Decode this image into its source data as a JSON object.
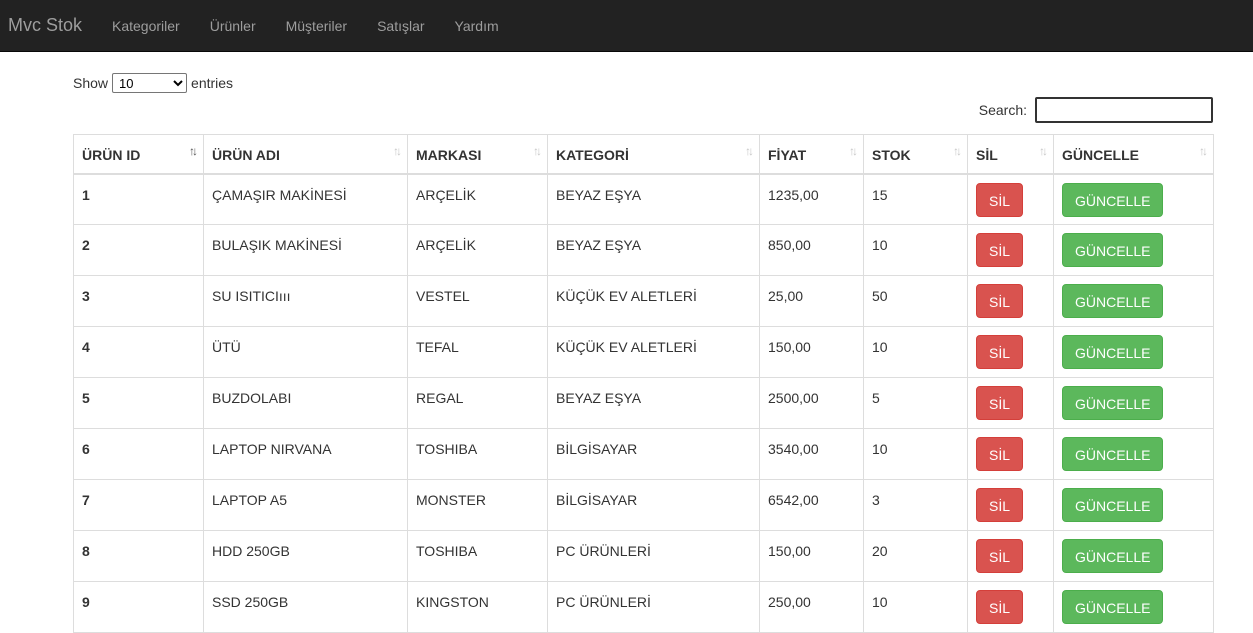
{
  "navbar": {
    "brand": "Mvc Stok",
    "links": [
      "Kategoriler",
      "Ürünler",
      "Müşteriler",
      "Satışlar",
      "Yardım"
    ]
  },
  "length": {
    "show_label": "Show",
    "selected": "10",
    "entries_label": "entries"
  },
  "search": {
    "label": "Search:",
    "value": ""
  },
  "table": {
    "headers": [
      "ÜRÜN ID",
      "ÜRÜN ADI",
      "MARKASI",
      "KATEGORİ",
      "FİYAT",
      "STOK",
      "SİL",
      "GÜNCELLE"
    ],
    "delete_label": "SİL",
    "update_label": "GÜNCELLE",
    "rows": [
      {
        "id": "1",
        "name": "ÇAMAŞIR MAKİNESİ",
        "brand": "ARÇELİK",
        "category": "BEYAZ EŞYA",
        "price": "1235,00",
        "stock": "15"
      },
      {
        "id": "2",
        "name": "BULAŞIK MAKİNESİ",
        "brand": "ARÇELİK",
        "category": "BEYAZ EŞYA",
        "price": "850,00",
        "stock": "10"
      },
      {
        "id": "3",
        "name": "SU ISITICIııı",
        "brand": "VESTEL",
        "category": "KÜÇÜK EV ALETLERİ",
        "price": "25,00",
        "stock": "50"
      },
      {
        "id": "4",
        "name": "ÜTÜ",
        "brand": "TEFAL",
        "category": "KÜÇÜK EV ALETLERİ",
        "price": "150,00",
        "stock": "10"
      },
      {
        "id": "5",
        "name": "BUZDOLABI",
        "brand": "REGAL",
        "category": "BEYAZ EŞYA",
        "price": "2500,00",
        "stock": "5"
      },
      {
        "id": "6",
        "name": "LAPTOP NIRVANA",
        "brand": "TOSHIBA",
        "category": "BİLGİSAYAR",
        "price": "3540,00",
        "stock": "10"
      },
      {
        "id": "7",
        "name": "LAPTOP A5",
        "brand": "MONSTER",
        "category": "BİLGİSAYAR",
        "price": "6542,00",
        "stock": "3"
      },
      {
        "id": "8",
        "name": "HDD 250GB",
        "brand": "TOSHIBA",
        "category": "PC ÜRÜNLERİ",
        "price": "150,00",
        "stock": "20"
      },
      {
        "id": "9",
        "name": "SSD 250GB",
        "brand": "KINGSTON",
        "category": "PC ÜRÜNLERİ",
        "price": "250,00",
        "stock": "10"
      }
    ]
  }
}
